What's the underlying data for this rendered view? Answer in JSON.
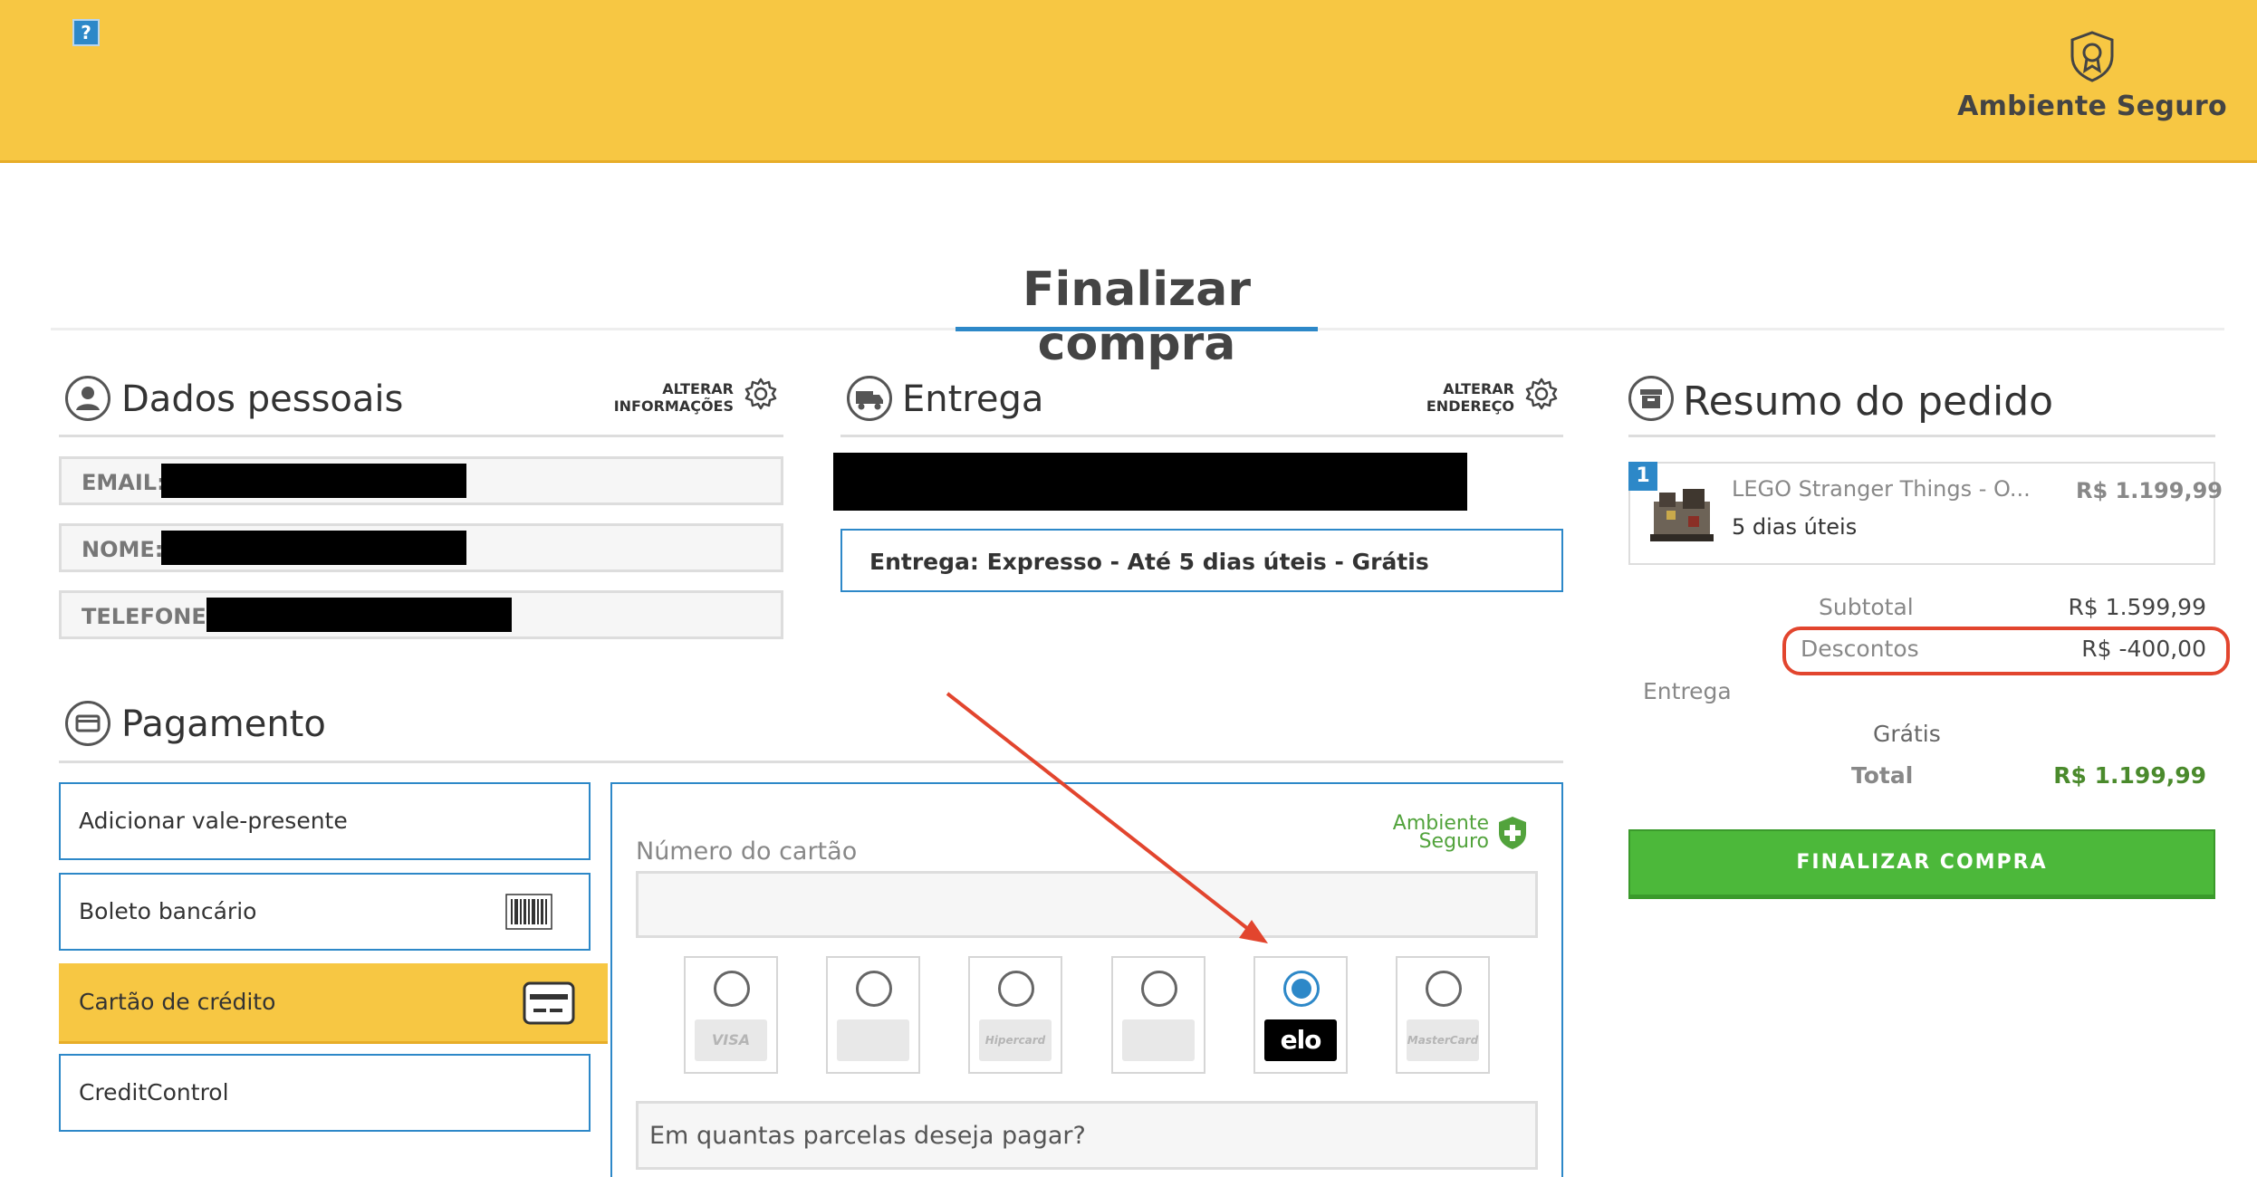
{
  "header": {
    "help_label": "?",
    "secure_label": "Ambiente Seguro",
    "icon": "award-shield-icon",
    "background": "#f7c743"
  },
  "page_title": "Finalizar compra",
  "personal": {
    "title": "Dados pessoais",
    "alter_line1": "ALTERAR",
    "alter_line2": "INFORMAÇÕES",
    "fields": [
      {
        "label": "EMAIL:"
      },
      {
        "label": "NOME:"
      },
      {
        "label": "TELEFONE:"
      }
    ]
  },
  "delivery": {
    "title": "Entrega",
    "alter_line1": "ALTERAR",
    "alter_line2": "ENDEREÇO",
    "option": "Entrega: Expresso - Até 5 dias úteis - Grátis"
  },
  "payment": {
    "title": "Pagamento",
    "methods": [
      {
        "label": "Adicionar vale-presente",
        "active": false
      },
      {
        "label": "Boleto bancário",
        "active": false,
        "icon": "barcode-icon"
      },
      {
        "label": "Cartão de crédito",
        "active": true,
        "icon": "credit-card-icon"
      },
      {
        "label": "CreditControl",
        "active": false
      }
    ],
    "secure_badge_line1": "Ambiente",
    "secure_badge_line2": "Seguro",
    "card_number_label": "Número do cartão",
    "brands": [
      {
        "name": "VISA",
        "selected": false
      },
      {
        "name": "",
        "selected": false
      },
      {
        "name": "Hipercard",
        "selected": false
      },
      {
        "name": "",
        "selected": false
      },
      {
        "name": "elo",
        "selected": true
      },
      {
        "name": "MasterCard",
        "selected": false
      }
    ],
    "installments_placeholder": "Em quantas parcelas deseja pagar?"
  },
  "summary": {
    "title": "Resumo do pedido",
    "item": {
      "qty": "1",
      "name": "LEGO Stranger Things - O...",
      "shipping": "5 dias úteis",
      "price": "R$ 1.199,99"
    },
    "subtotal_label": "Subtotal",
    "subtotal_value": "R$ 1.599,99",
    "discount_label": "Descontos",
    "discount_value": "R$ -400,00",
    "shipping_label": "Entrega",
    "shipping_value": "Grátis",
    "total_label": "Total",
    "total_value": "R$ 1.199,99",
    "finalize_label": "FINALIZAR COMPRA"
  },
  "colors": {
    "accent_blue": "#2d88c8",
    "brand_yellow": "#f7c743",
    "success_green": "#4cb83a",
    "annotation_red": "#e2452e"
  }
}
